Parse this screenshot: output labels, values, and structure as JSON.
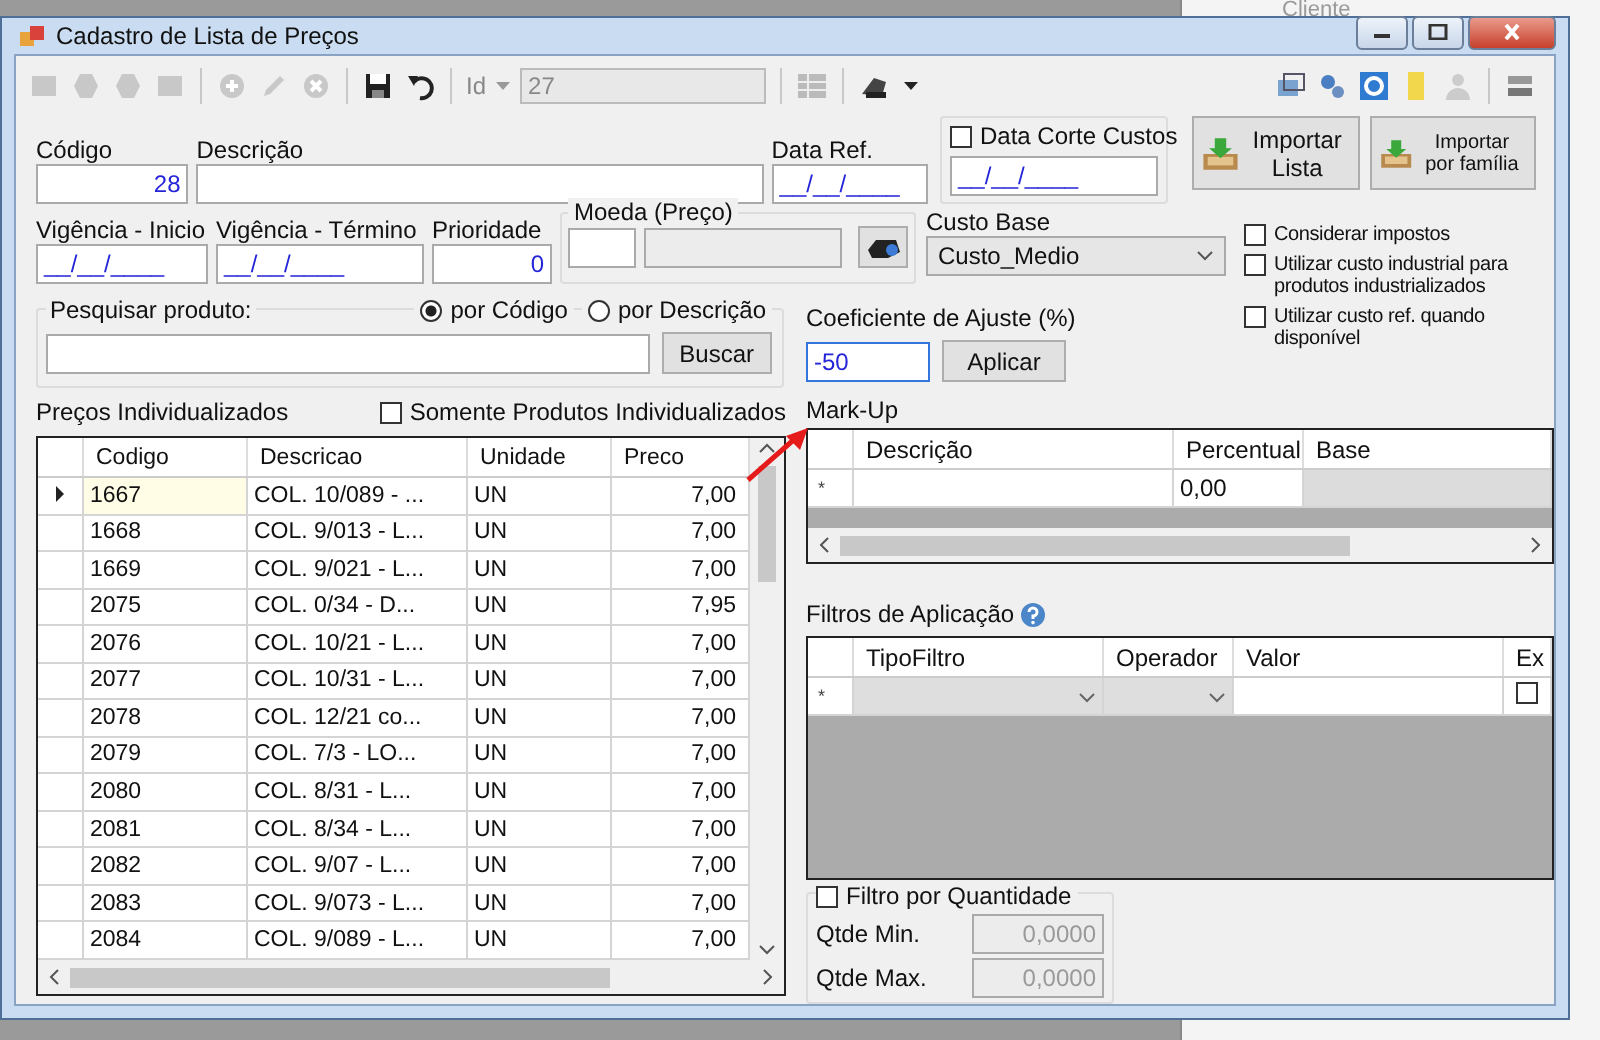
{
  "background_app": {
    "label": "Cliente"
  },
  "window": {
    "title": "Cadastro de Lista de Preços"
  },
  "toolbar": {
    "id_label": "Id",
    "id_value": "27"
  },
  "codigo": {
    "label": "Código",
    "value": "28"
  },
  "descricao": {
    "label": "Descrição"
  },
  "data_ref": {
    "label": "Data Ref.",
    "value": "__/__/____"
  },
  "data_corte": {
    "label": "Data Corte Custos",
    "checked": false,
    "value": "__/__/____"
  },
  "import_buttons": [
    {
      "label": "Importar Lista",
      "kind": "large"
    },
    {
      "label": "Importar por família",
      "kind": "compact"
    }
  ],
  "vigencia_inicio": {
    "label": "Vigência - Inicio",
    "value": "__/__/____"
  },
  "vigencia_termino": {
    "label": "Vigência - Término",
    "value": "__/__/____"
  },
  "prioridade": {
    "label": "Prioridade",
    "value": "0"
  },
  "moeda": {
    "label": "Moeda (Preço)"
  },
  "custo_base": {
    "label": "Custo Base",
    "value": "Custo_Medio"
  },
  "options": [
    {
      "label": "Considerar impostos",
      "checked": false
    },
    {
      "label": "Utilizar custo industrial para produtos industrializados",
      "checked": false
    },
    {
      "label": "Utilizar custo ref. quando disponível",
      "checked": false
    }
  ],
  "search": {
    "label": "Pesquisar produto:",
    "button": "Buscar"
  },
  "search_modes": [
    {
      "label": "por Código",
      "selected": true
    },
    {
      "label": "por Descrição",
      "selected": false
    }
  ],
  "coeficiente": {
    "label": "Coeficiente de Ajuste (%)",
    "value": "-50",
    "button": "Aplicar"
  },
  "precos": {
    "title": "Preços Individualizados",
    "filter_label": "Somente Produtos Individualizados",
    "filter_checked": false,
    "columns": [
      "Codigo",
      "Descricao",
      "Unidade",
      "Preco"
    ],
    "rows": [
      {
        "cells": [
          "1667",
          "COL. 10/089 - ...",
          "UN",
          "7,00"
        ],
        "selected": true
      },
      {
        "cells": [
          "1668",
          "COL. 9/013 - L...",
          "UN",
          "7,00"
        ],
        "selected": false
      },
      {
        "cells": [
          "1669",
          "COL. 9/021 - L...",
          "UN",
          "7,00"
        ],
        "selected": false
      },
      {
        "cells": [
          "2075",
          "COL. 0/34 - D...",
          "UN",
          "7,95"
        ],
        "selected": false
      },
      {
        "cells": [
          "2076",
          "COL. 10/21 - L...",
          "UN",
          "7,00"
        ],
        "selected": false
      },
      {
        "cells": [
          "2077",
          "COL. 10/31 - L...",
          "UN",
          "7,00"
        ],
        "selected": false
      },
      {
        "cells": [
          "2078",
          "COL. 12/21 co...",
          "UN",
          "7,00"
        ],
        "selected": false
      },
      {
        "cells": [
          "2079",
          "COL. 7/3 - LO...",
          "UN",
          "7,00"
        ],
        "selected": false
      },
      {
        "cells": [
          "2080",
          "COL. 8/31 - L...",
          "UN",
          "7,00"
        ],
        "selected": false
      },
      {
        "cells": [
          "2081",
          "COL. 8/34 - L...",
          "UN",
          "7,00"
        ],
        "selected": false
      },
      {
        "cells": [
          "2082",
          "COL. 9/07 - L...",
          "UN",
          "7,00"
        ],
        "selected": false
      },
      {
        "cells": [
          "2083",
          "COL. 9/073 - L...",
          "UN",
          "7,00"
        ],
        "selected": false
      },
      {
        "cells": [
          "2084",
          "COL. 9/089 - L...",
          "UN",
          "7,00"
        ],
        "selected": false
      }
    ]
  },
  "markup": {
    "title": "Mark-Up",
    "columns": [
      "Descrição",
      "Percentual",
      "Base"
    ],
    "new_row_marker": "*",
    "percentual": "0,00"
  },
  "filtros": {
    "title": "Filtros de Aplicação",
    "columns": [
      "TipoFiltro",
      "Operador",
      "Valor",
      "Ex"
    ],
    "new_row_marker": "*",
    "ex_checked": false
  },
  "filtro_quantidade": {
    "label": "Filtro por Quantidade",
    "checked": false,
    "min_label": "Qtde Min.",
    "min_value": "0,0000",
    "max_label": "Qtde Max.",
    "max_value": "0,0000"
  }
}
